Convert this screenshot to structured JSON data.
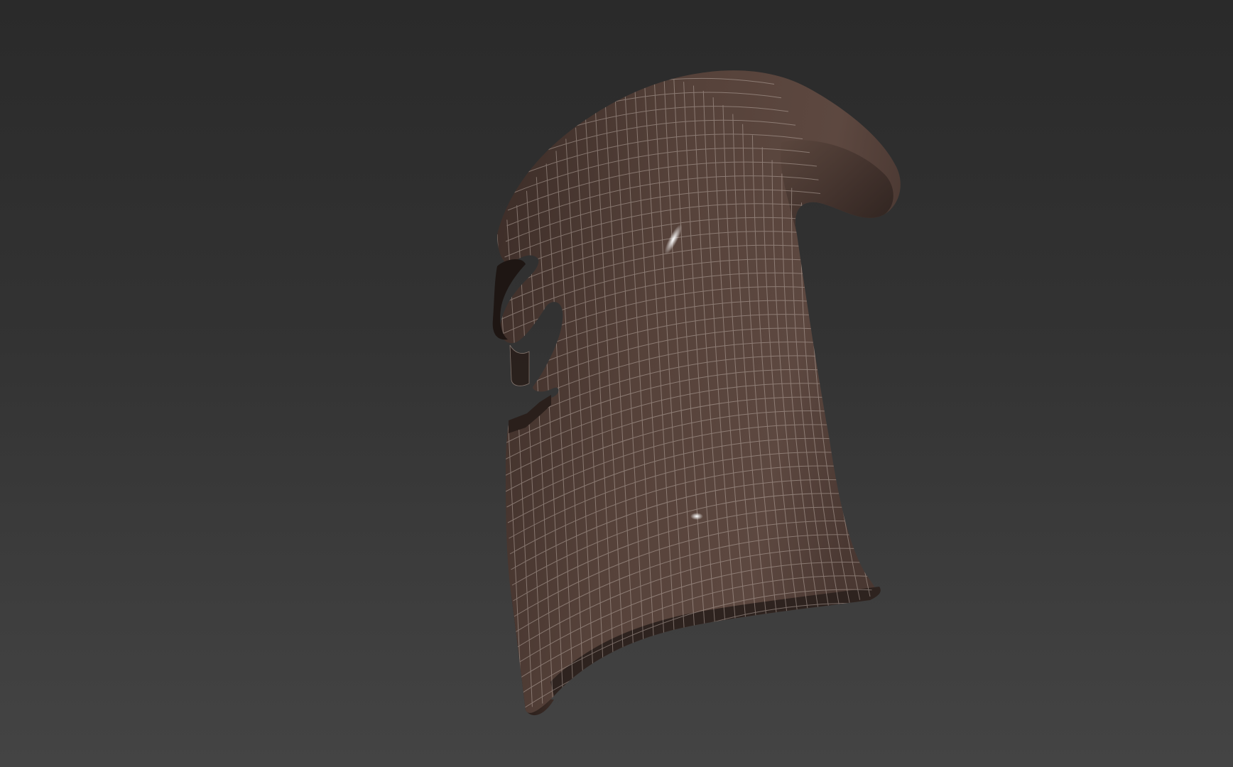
{
  "viewport": {
    "background_top": "#2a2a2a",
    "background_bottom": "#444444"
  },
  "model": {
    "icon": "helmet-mesh-icon",
    "surface_color": "#4d3a33",
    "surface_light": "#6b544a",
    "surface_dark": "#2a1f1b",
    "wire_color": "#b8aaa2",
    "highlight_color": "#f2f2f2"
  }
}
